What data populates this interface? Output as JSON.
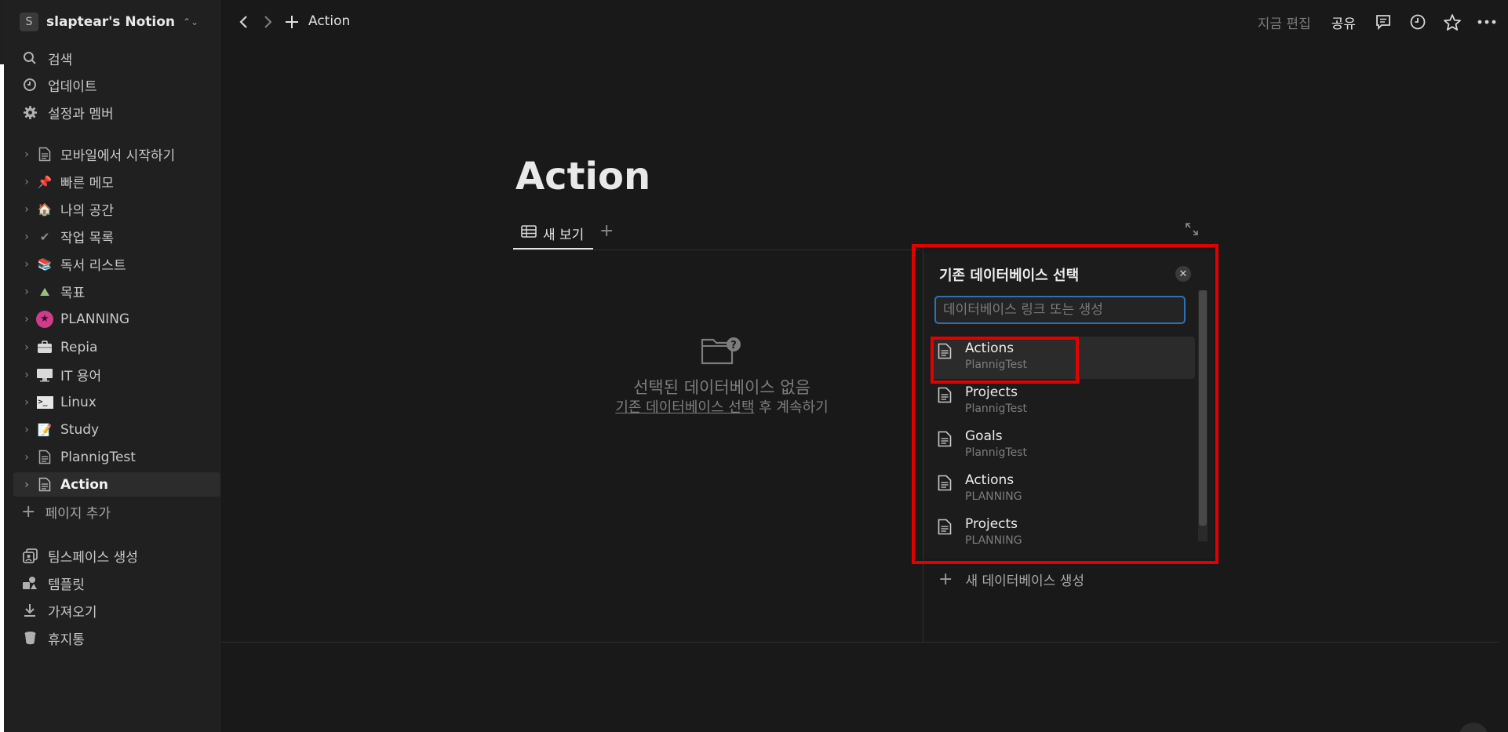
{
  "workspace": {
    "avatar_letter": "S",
    "name": "slaptear's Notion",
    "switch_icon": "chevron-up-down-icon"
  },
  "sidebar": {
    "nav": [
      {
        "label": "검색",
        "icon": "search-icon"
      },
      {
        "label": "업데이트",
        "icon": "clock-icon"
      },
      {
        "label": "설정과 멤버",
        "icon": "gear-icon"
      }
    ],
    "pages": [
      {
        "label": "모바일에서 시작하기",
        "icon": "document-icon",
        "emoji": ""
      },
      {
        "label": "빠른 메모",
        "icon": "pushpin-icon",
        "emoji": "📌"
      },
      {
        "label": "나의 공간",
        "icon": "house-icon",
        "emoji": "🏠"
      },
      {
        "label": "작업 목록",
        "icon": "checkmark-icon",
        "emoji": "✔"
      },
      {
        "label": "독서 리스트",
        "icon": "books-icon",
        "emoji": "📚"
      },
      {
        "label": "목표",
        "icon": "mountain-icon",
        "emoji": "⛰"
      },
      {
        "label": "PLANNING",
        "icon": "star-badge-icon",
        "emoji": "★"
      },
      {
        "label": "Repia",
        "icon": "briefcase-icon",
        "emoji": "💼"
      },
      {
        "label": "IT 용어",
        "icon": "monitor-icon",
        "emoji": "🖥"
      },
      {
        "label": "Linux",
        "icon": "terminal-icon",
        "emoji": ">_"
      },
      {
        "label": "Study",
        "icon": "memo-icon",
        "emoji": "📝"
      },
      {
        "label": "PlannigTest",
        "icon": "document-icon",
        "emoji": ""
      },
      {
        "label": "Action",
        "icon": "document-icon",
        "emoji": ""
      }
    ],
    "add_page": "페이지 추가",
    "bottom": [
      {
        "label": "팀스페이스 생성",
        "icon": "teamspace-icon"
      },
      {
        "label": "템플릿",
        "icon": "shapes-icon"
      },
      {
        "label": "가져오기",
        "icon": "download-icon"
      },
      {
        "label": "휴지통",
        "icon": "trash-icon"
      }
    ]
  },
  "topbar": {
    "breadcrumb": "Action",
    "editing_text": "지금 편집",
    "share_label": "공유"
  },
  "page": {
    "title": "Action",
    "view_tab_label": "새 보기",
    "empty_title": "선택된 데이터베이스 없음",
    "empty_link": "기존 데이터베이스 선택",
    "empty_suffix": " 후 계속하기"
  },
  "db_picker": {
    "title": "기존 데이터베이스 선택",
    "search_placeholder": "데이터베이스 링크 또는 생성",
    "items": [
      {
        "name": "Actions",
        "source": "PlannigTest"
      },
      {
        "name": "Projects",
        "source": "PlannigTest"
      },
      {
        "name": "Goals",
        "source": "PlannigTest"
      },
      {
        "name": "Actions",
        "source": "PLANNING"
      },
      {
        "name": "Projects",
        "source": "PLANNING"
      }
    ],
    "new_db_label": "새 데이터베이스 생성"
  },
  "colors": {
    "background": "#191919",
    "sidebar": "#202020",
    "focus_border": "#2f6fb3",
    "highlight_red": "#e30000",
    "planning_badge": "#d13c8a",
    "pin_red": "#e0443e"
  }
}
